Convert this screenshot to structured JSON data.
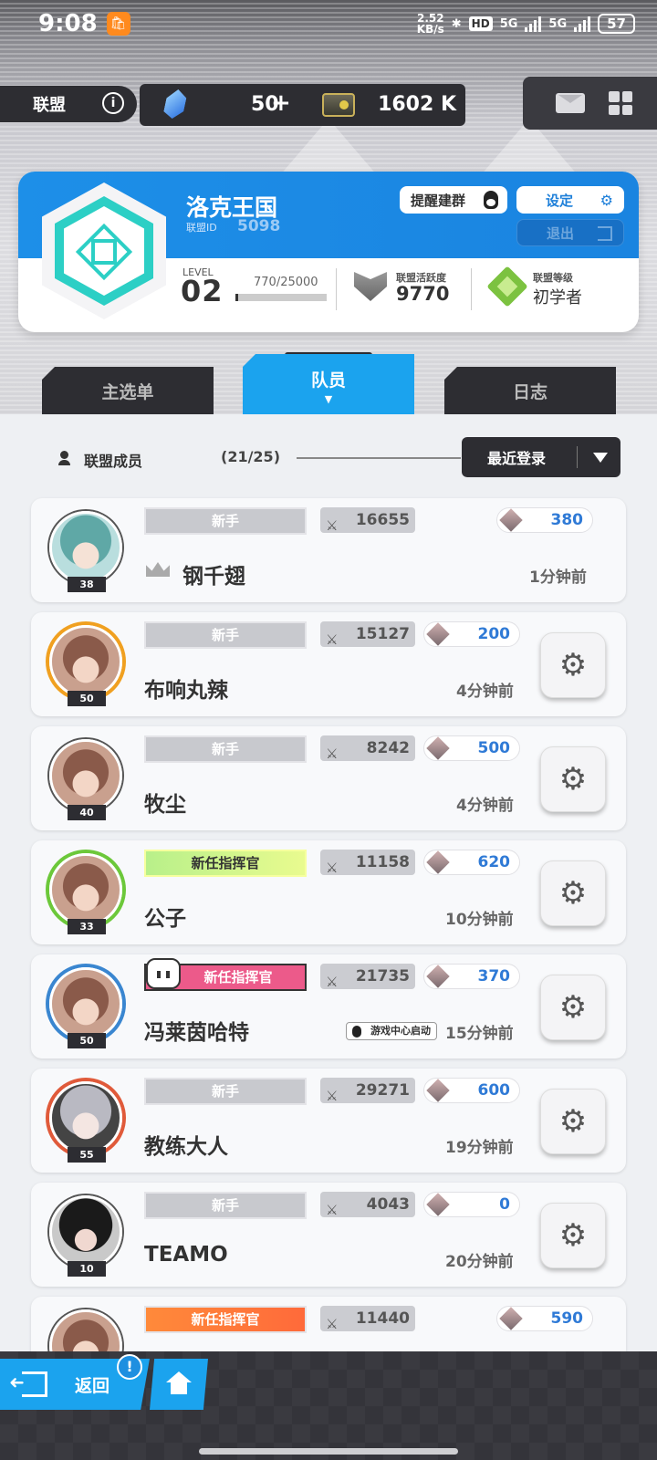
{
  "status_bar": {
    "time": "9:08",
    "speed_value": "2.52",
    "speed_unit": "KB/s",
    "hd": "HD",
    "net1": "5G",
    "net2": "5G",
    "battery": "57"
  },
  "top_bar": {
    "alliance_label": "联盟",
    "info_icon": "i",
    "resource1": "50",
    "resource1_plus": "+",
    "resource2": "1602 K",
    "icons": [
      "info-icon",
      "crystal-icon",
      "card-icon",
      "mail-icon",
      "grid-menu-icon"
    ]
  },
  "alliance": {
    "name": "洛克王国",
    "id_label": "联盟ID",
    "id": "5098",
    "remind_button": "提醒建群",
    "settings_button": "设定",
    "exit_button": "退出",
    "level_label": "LEVEL",
    "level": "02",
    "xp_text": "770/25000",
    "xp_fraction": 0.0308,
    "activity_label": "联盟活跃度",
    "activity_value": "9770",
    "rank_label": "联盟等级",
    "rank_value": "初学者"
  },
  "tabs": {
    "main": "主选单",
    "members": "队员",
    "log": "日志",
    "active_arrow": "▼"
  },
  "members_header": {
    "label": "联盟成员",
    "count": "(21/25)",
    "sort_label": "最近登录"
  },
  "members": [
    {
      "title": "新手",
      "power": "16655",
      "gems": "380",
      "name": "钢千翅",
      "login": "1分钟前",
      "level": "38",
      "leader": true
    },
    {
      "title": "新手",
      "power": "15127",
      "gems": "200",
      "name": "布响丸辣",
      "login": "4分钟前",
      "level": "50"
    },
    {
      "title": "新手",
      "power": "8242",
      "gems": "500",
      "name": "牧尘",
      "login": "4分钟前",
      "level": "40"
    },
    {
      "title": "新任指挥官",
      "power": "11158",
      "gems": "620",
      "name": "公子",
      "login": "10分钟前",
      "level": "33"
    },
    {
      "title": "新任指挥官",
      "power": "21735",
      "gems": "370",
      "name": "冯莱茵哈特",
      "login": "15分钟前",
      "level": "50",
      "tag": "游戏中心启动"
    },
    {
      "title": "新手",
      "power": "29271",
      "gems": "600",
      "name": "教练大人",
      "login": "19分钟前",
      "level": "55"
    },
    {
      "title": "新手",
      "power": "4043",
      "gems": "0",
      "name": "TEAMO",
      "login": "20分钟前",
      "level": "10"
    },
    {
      "title": "新任指挥官",
      "power": "11440",
      "gems": "590"
    }
  ],
  "bottom": {
    "back": "返回",
    "alert": "!"
  },
  "colors": {
    "accent": "#1ba3ee",
    "alliance_blue": "#1d8fe8",
    "dark_panel": "#2d2d32",
    "gem_text": "#2f7ad6"
  }
}
